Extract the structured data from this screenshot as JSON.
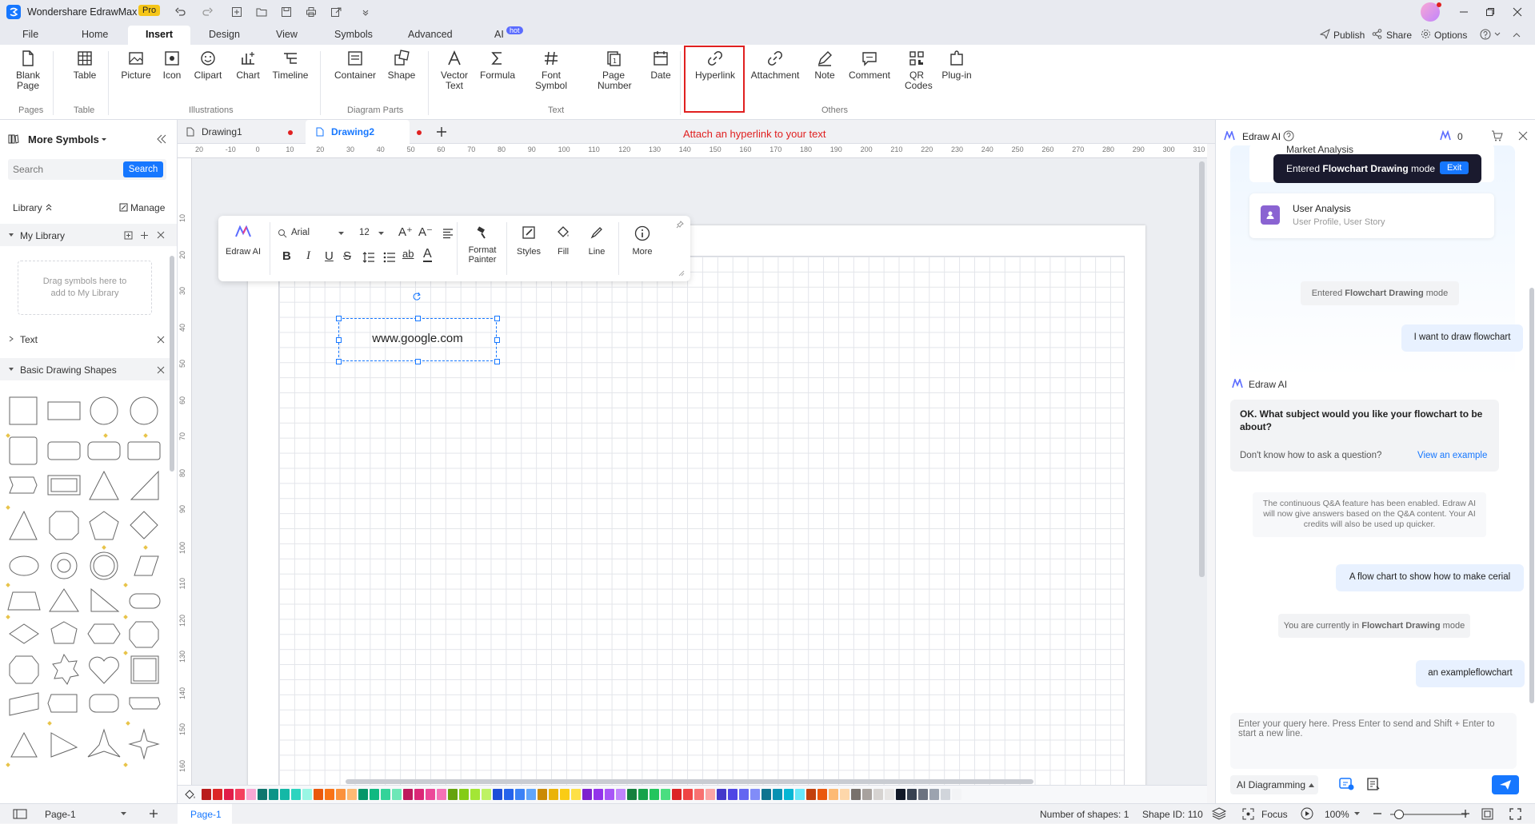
{
  "app": {
    "title": "Wondershare EdrawMax",
    "badge": "Pro"
  },
  "titlebar_right": {
    "publish": "Publish",
    "share": "Share",
    "options": "Options"
  },
  "menu": {
    "tabs": [
      "File",
      "Home",
      "Insert",
      "Design",
      "View",
      "Symbols",
      "Advanced",
      "AI"
    ],
    "active": "Insert",
    "ai_badge": "hot"
  },
  "ribbon": {
    "pages": {
      "blank_page": "Blank Page",
      "group": "Pages"
    },
    "table": {
      "table": "Table",
      "group": "Table"
    },
    "illustrations": {
      "picture": "Picture",
      "icon": "Icon",
      "clipart": "Clipart",
      "chart": "Chart",
      "timeline": "Timeline",
      "group": "Illustrations"
    },
    "diagram_parts": {
      "container": "Container",
      "shape": "Shape",
      "group": "Diagram Parts"
    },
    "text": {
      "vector_text": "Vector Text",
      "formula": "Formula",
      "font_symbol": "Font Symbol",
      "page_number": "Page Number",
      "date": "Date",
      "group": "Text"
    },
    "others": {
      "hyperlink": "Hyperlink",
      "attachment": "Attachment",
      "note": "Note",
      "comment": "Comment",
      "qr_codes": "QR Codes",
      "plugin": "Plug-in",
      "group": "Others"
    }
  },
  "annotation": "Attach an hyperlink to your text",
  "doc_tabs": [
    {
      "name": "Drawing1"
    },
    {
      "name": "Drawing2"
    }
  ],
  "left_panel": {
    "title": "More Symbols",
    "search_placeholder": "Search",
    "search_button": "Search",
    "library": "Library",
    "manage": "Manage",
    "my_library": "My Library",
    "drag_hint": "Drag symbols here to add to My Library",
    "text_section": "Text",
    "basic_shapes": "Basic Drawing Shapes"
  },
  "ruler_top": [
    "20",
    "-10",
    "0",
    "10",
    "20",
    "30",
    "40",
    "50",
    "60",
    "70",
    "80",
    "90",
    "100",
    "110",
    "120",
    "130",
    "140",
    "150",
    "160",
    "170",
    "180",
    "190",
    "200",
    "210",
    "220",
    "230",
    "240",
    "250",
    "260",
    "270",
    "280",
    "290",
    "300",
    "310"
  ],
  "ruler_left": [
    "10",
    "20",
    "30",
    "40",
    "50",
    "60",
    "70",
    "80",
    "90",
    "100",
    "110",
    "120",
    "130",
    "140",
    "150",
    "160",
    "170"
  ],
  "floating_toolbar": {
    "edraw_ai": "Edraw AI",
    "font": "Arial",
    "size": "12",
    "format_painter": "Format Painter",
    "styles": "Styles",
    "fill": "Fill",
    "line": "Line",
    "more": "More"
  },
  "canvas_text": "www.google.com",
  "right_panel": {
    "title": "Edraw AI",
    "credits": "0",
    "toast": {
      "prefix": "Entered ",
      "bold": "Flowchart Drawing",
      "suffix": " mode",
      "exit": "Exit"
    },
    "card_partial": "Market Analysis",
    "card2_title": "User Analysis",
    "card2_sub": "User Profile, User Story",
    "mode1": {
      "prefix": "Entered ",
      "bold": "Flowchart Drawing",
      "suffix": " mode"
    },
    "user1": "I want to draw flowchart",
    "ai_name": "Edraw AI",
    "ai_question": "OK. What subject would you like your flowchart to be about?",
    "ai_hint": "Don't know how to ask a question?",
    "ai_example": "View an example",
    "notice": "The continuous Q&A feature has been enabled. Edraw AI will now give answers based on the Q&A content. Your AI credits will also be used up quicker.",
    "user2": "A flow chart to show how to make cerial",
    "mode2": {
      "prefix": "You are currently in ",
      "bold": "Flowchart Drawing",
      "suffix": " mode"
    },
    "user3": "an exampleflowchart",
    "input_placeholder": "Enter your query here. Press Enter to send and Shift + Enter to start a new line.",
    "mode_select": "AI Diagramming"
  },
  "status": {
    "page_select": "Page-1",
    "page_tab": "Page-1",
    "shapes": "Number of shapes: 1",
    "shape_id": "Shape ID: 110",
    "focus": "Focus",
    "zoom": "100%"
  },
  "colors": {
    "accent": "#1677ff",
    "highlight": "#e02020",
    "ribbon_bg": "#ffffff"
  },
  "palette": [
    "#b91c1c",
    "#dc2626",
    "#e11d48",
    "#f43f5e",
    "#f9a8d4",
    "#0f766e",
    "#0d9488",
    "#14b8a6",
    "#2dd4bf",
    "#99f6e4",
    "#ea580c",
    "#f97316",
    "#fb923c",
    "#fdba74",
    "#059669",
    "#10b981",
    "#34d399",
    "#6ee7b7",
    "#be185d",
    "#db2777",
    "#ec4899",
    "#f472b6",
    "#65a30d",
    "#84cc16",
    "#a3e635",
    "#bef264",
    "#1d4ed8",
    "#2563eb",
    "#3b82f6",
    "#60a5fa",
    "#ca8a04",
    "#eab308",
    "#facc15",
    "#fde047",
    "#7e22ce",
    "#9333ea",
    "#a855f7",
    "#c084fc",
    "#15803d",
    "#16a34a",
    "#22c55e",
    "#4ade80",
    "#dc2626",
    "#ef4444",
    "#f87171",
    "#fca5a5",
    "#4338ca",
    "#4f46e5",
    "#6366f1",
    "#818cf8",
    "#0e7490",
    "#0891b2",
    "#06b6d4",
    "#67e8f9",
    "#c2410c",
    "#ea580c",
    "#fdba74",
    "#fed7aa",
    "#78716c",
    "#a8a29e",
    "#d6d3d1",
    "#e7e5e4",
    "#111827",
    "#374151",
    "#6b7280",
    "#9ca3af",
    "#d1d5db",
    "#f3f4f6"
  ]
}
